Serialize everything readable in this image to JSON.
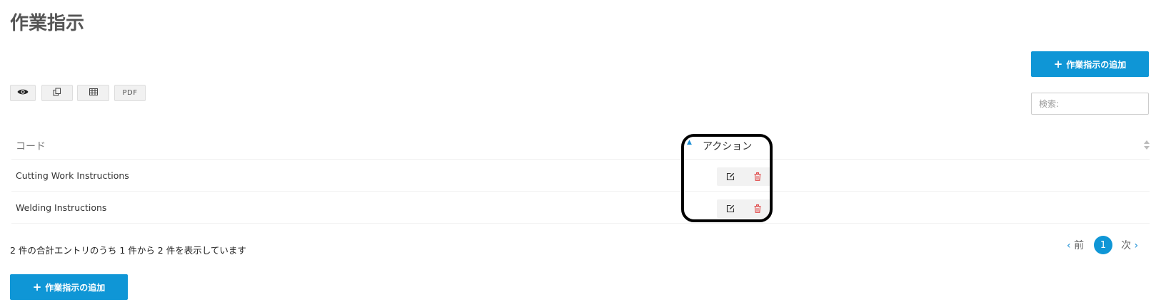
{
  "page": {
    "title": "作業指示"
  },
  "buttons": {
    "add_label": "作業指示の追加",
    "add_plus": "+"
  },
  "toolbar": {
    "view_icon": "eye-icon",
    "copy_icon": "copy-icon",
    "csv_icon": "table-icon",
    "pdf_label": "PDF"
  },
  "search": {
    "placeholder": "検索:",
    "value": ""
  },
  "table": {
    "headers": {
      "code": "コード",
      "action": "アクション"
    },
    "rows": [
      {
        "code": "Cutting Work Instructions",
        "edit_icon": "edit-icon",
        "delete_icon": "trash-icon"
      },
      {
        "code": "Welding Instructions",
        "edit_icon": "edit-icon",
        "delete_icon": "trash-icon"
      }
    ],
    "sort_indicator_icon": "sort-asc-icon"
  },
  "info": {
    "text": "2 件の合計エントリのうち 1 件から 2 件を表示しています"
  },
  "pagination": {
    "prev": "前",
    "current": "1",
    "next": "次",
    "prev_chevron": "‹",
    "next_chevron": "›"
  },
  "colors": {
    "accent": "#0f96d6",
    "delete": "#e04646",
    "highlight_border": "#000000"
  }
}
